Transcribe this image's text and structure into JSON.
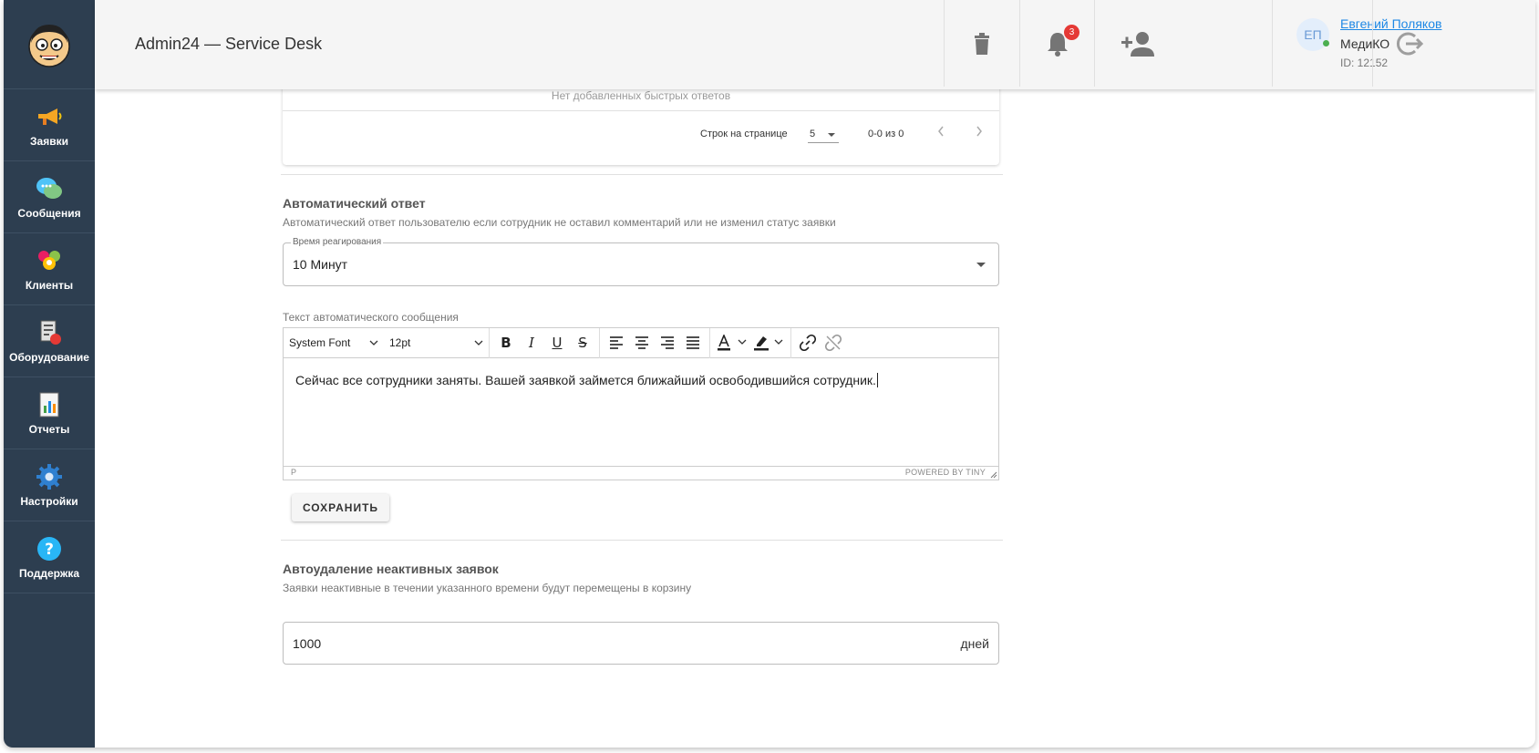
{
  "header": {
    "title": "Admin24 — Service Desk",
    "notifications_count": "3",
    "user": {
      "initials": "ЕП",
      "name": "Евгений Поляков",
      "org": "МедиКО",
      "id": "ID: 12152"
    }
  },
  "sidebar": {
    "items": [
      {
        "label": "Заявки",
        "icon": "megaphone-icon"
      },
      {
        "label": "Сообщения",
        "icon": "chat-bubbles-icon"
      },
      {
        "label": "Клиенты",
        "icon": "clients-icon"
      },
      {
        "label": "Оборудование",
        "icon": "equipment-icon"
      },
      {
        "label": "Отчеты",
        "icon": "report-icon"
      },
      {
        "label": "Настройки",
        "icon": "gear-icon"
      },
      {
        "label": "Поддержка",
        "icon": "help-icon"
      }
    ]
  },
  "quick_replies": {
    "empty_text": "Нет добавленных быстрых ответов",
    "rows_per_page_label": "Строк на странице",
    "rows_per_page_value": "5",
    "range_text": "0-0 из 0"
  },
  "auto_reply": {
    "title": "Автоматический ответ",
    "description": "Автоматический ответ пользователю если сотрудник не оставил комментарий или не изменил статус заявки",
    "reaction_time_label": "Время реагирования",
    "reaction_time_value": "10 Минут",
    "message_label": "Текст автоматического сообщения",
    "font_family": "System Font",
    "font_size": "12pt",
    "message_text": "Сейчас все сотрудники заняты. Вашей заявкой займется ближайший освободившийся сотрудник.",
    "status_path": "P",
    "powered_by": "POWERED BY TINY",
    "save_label": "СОХРАНИТЬ"
  },
  "auto_delete": {
    "title": "Автоудаление неактивных заявок",
    "description": "Заявки неактивные в течении указанного времени будут перемещены в корзину",
    "value": "1000",
    "unit": "дней"
  }
}
